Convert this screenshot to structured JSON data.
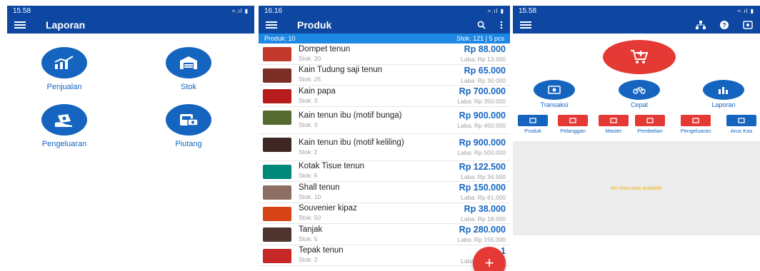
{
  "colors": {
    "primary": "#0d47a1",
    "accent": "#1565c0",
    "sub": "#1e88e5",
    "red": "#e53935",
    "gold": "#f6b300"
  },
  "screen1": {
    "time": "15.58",
    "status_icons": "≈.ıl ▮",
    "title": "Laporan",
    "tiles": [
      {
        "label": "Penjualan",
        "icon": "chart-up-icon"
      },
      {
        "label": "Stok",
        "icon": "warehouse-icon"
      },
      {
        "label": "Pengeluaran",
        "icon": "money-hand-icon"
      },
      {
        "label": "Piutang",
        "icon": "payment-card-icon"
      }
    ]
  },
  "screen2": {
    "time": "16.16",
    "status_icons": "≈.ıl ▮",
    "title": "Produk",
    "summary_left": "Produk: 10",
    "summary_right": "Stok: 121  |  5 pcs",
    "products": [
      {
        "name": "Dompet tenun",
        "stok": "Stok: 20",
        "price": "Rp 88.000",
        "laba": "Laba: Rp 13.000",
        "color": "#c0392b"
      },
      {
        "name": "Kain Tudung saji tenun",
        "stok": "Stok: 25",
        "price": "Rp 65.000",
        "laba": "Laba: Rp 30.000",
        "color": "#7b2d26"
      },
      {
        "name": "Kain papa",
        "stok": "Stok: 3",
        "price": "Rp 700.000",
        "laba": "Laba: Rp 350.000",
        "color": "#b71c1c"
      },
      {
        "name": "Kain tenun ibu (motif bunga)",
        "stok": "Stok: 3",
        "price": "Rp 900.000",
        "laba": "Laba: Rp 450.000",
        "color": "#556b2f"
      },
      {
        "name": "Kain tenun ibu (motif keliling)",
        "stok": "Stok: 2",
        "price": "Rp 900.000",
        "laba": "Laba: Rp 500.000",
        "color": "#3e2723"
      },
      {
        "name": "Kotak Tisue tenun",
        "stok": "Stok: 6",
        "price": "Rp 122.500",
        "laba": "Laba: Rp 34.500",
        "color": "#00897b"
      },
      {
        "name": "Shall tenun",
        "stok": "Stok: 10",
        "price": "Rp 150.000",
        "laba": "Laba: Rp 61.000",
        "color": "#8d6e63"
      },
      {
        "name": "Souvenier kipaz",
        "stok": "Stok: 50",
        "price": "Rp 38.000",
        "laba": "Laba: Rp 18.000",
        "color": "#d84315"
      },
      {
        "name": "Tanjak",
        "stok": "Stok: 5",
        "price": "Rp 280.000",
        "laba": "Laba: Rp 155.000",
        "color": "#4e342e"
      },
      {
        "name": "Tepak tenun",
        "stok": "Stok: 2",
        "price": "Rp 1",
        "laba": "Laba: Rp 45.000",
        "color": "#c62828"
      }
    ],
    "fab_label": "+"
  },
  "screen3": {
    "time": "15.58",
    "status_icons": "≈.ıl ▮",
    "quick_actions": [
      {
        "label": "Transaksi",
        "icon": "money-icon"
      },
      {
        "label": "Cepat",
        "icon": "bike-icon"
      },
      {
        "label": "Laporan",
        "icon": "bar-chart-icon"
      }
    ],
    "shortcuts": [
      {
        "label": "Produk",
        "color": "#1565c0"
      },
      {
        "label": "Pelanggan",
        "color": "#e53935"
      },
      {
        "label": "Master",
        "color": "#e53935"
      },
      {
        "label": "Pembelian",
        "color": "#e53935"
      },
      {
        "label": "Pengeluaran",
        "color": "#e53935"
      },
      {
        "label": "Arus Kas",
        "color": "#1565c0"
      }
    ],
    "chart_message": "No chart data available"
  }
}
